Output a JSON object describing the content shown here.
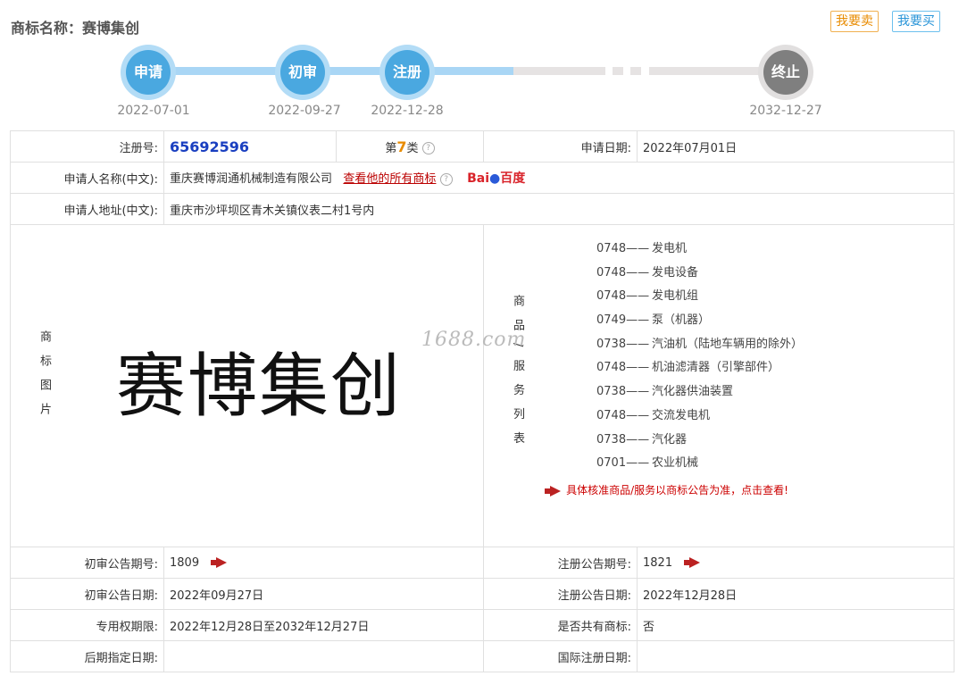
{
  "header": {
    "title_label": "商标名称：",
    "title_name": "赛博集创",
    "sell_button": "我要卖",
    "buy_button": "我要买"
  },
  "progress": {
    "steps": [
      {
        "label": "申请",
        "date": "2022-07-01",
        "status": "done"
      },
      {
        "label": "初审",
        "date": "2022-09-27",
        "status": "done"
      },
      {
        "label": "注册",
        "date": "2022-12-28",
        "status": "done"
      },
      {
        "label": "终止",
        "date": "2032-12-27",
        "status": "pending"
      }
    ]
  },
  "info": {
    "reg_no_label": "注册号:",
    "reg_no": "65692596",
    "class_prefix": "第",
    "class_num": "7",
    "class_suffix": "类",
    "apply_date_label": "申请日期:",
    "apply_date": "2022年07月01日",
    "applicant_label": "申请人名称(中文):",
    "applicant": "重庆赛博润通机械制造有限公司",
    "all_marks_link": "查看他的所有商标",
    "baidu_text": "Bai百度",
    "address_label": "申请人地址(中文):",
    "address": "重庆市沙坪坝区青木关镇仪表二村1号内",
    "image_label": "商标图片",
    "trademark_text": "赛博集创",
    "watermark": "1688.com",
    "goods_label": "商品/服务列表",
    "goods": [
      {
        "code": "0748——",
        "name": "发电机"
      },
      {
        "code": "0748——",
        "name": "发电设备"
      },
      {
        "code": "0748——",
        "name": "发电机组"
      },
      {
        "code": "0749——",
        "name": "泵（机器）"
      },
      {
        "code": "0738——",
        "name": "汽油机（陆地车辆用的除外）"
      },
      {
        "code": "0748——",
        "name": "机油滤清器（引擎部件）"
      },
      {
        "code": "0738——",
        "name": "汽化器供油装置"
      },
      {
        "code": "0748——",
        "name": "交流发电机"
      },
      {
        "code": "0738——",
        "name": "汽化器"
      },
      {
        "code": "0701——",
        "name": "农业机械"
      }
    ],
    "goods_notice": "具体核准商品/服务以商标公告为准，点击查看!",
    "prelim_no_label": "初审公告期号:",
    "prelim_no": "1809",
    "reg_pub_no_label": "注册公告期号:",
    "reg_pub_no": "1821",
    "prelim_date_label": "初审公告日期:",
    "prelim_date": "2022年09月27日",
    "reg_pub_date_label": "注册公告日期:",
    "reg_pub_date": "2022年12月28日",
    "valid_period_label": "专用权期限:",
    "valid_period": "2022年12月28日至2032年12月27日",
    "shared_label": "是否共有商标:",
    "shared": "否",
    "later_date_label": "后期指定日期:",
    "later_date": "",
    "intl_date_label": "国际注册日期:",
    "intl_date": ""
  }
}
